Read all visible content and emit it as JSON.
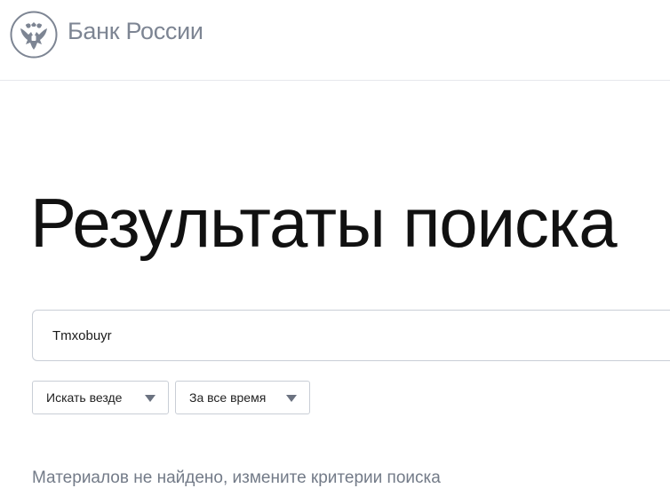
{
  "header": {
    "logo_text": "Банк России"
  },
  "page": {
    "title": "Результаты поиска"
  },
  "search": {
    "value": "Tmxobuyr"
  },
  "filters": {
    "scope": {
      "selected": "Искать везде"
    },
    "period": {
      "selected": "За все время"
    }
  },
  "results": {
    "empty_message": "Материалов не найдено, измените критерии поиска"
  },
  "colors": {
    "logo_gray": "#7d8593",
    "title": "#111111",
    "border": "#c9ced6",
    "muted_text": "#737b88"
  },
  "icons": {
    "logo": "double-headed-eagle-emblem",
    "dropdown": "chevron-down-triangle"
  }
}
